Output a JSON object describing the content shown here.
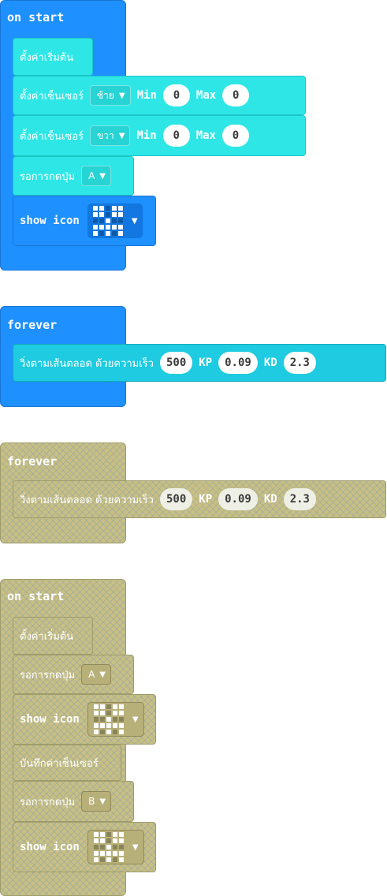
{
  "block1": {
    "hat": "on start",
    "init_label": "ตั้งค่าเริ่มต้น",
    "sensor_left": {
      "label": "ตั้งค่าเซ็นเซอร์",
      "side": "ซ้าย",
      "min_label": "Min",
      "min": "0",
      "max_label": "Max",
      "max": "0"
    },
    "sensor_right": {
      "label": "ตั้งค่าเซ็นเซอร์",
      "side": "ขวา",
      "min_label": "Min",
      "min": "0",
      "max_label": "Max",
      "max": "0"
    },
    "wait_button": {
      "label": "รอการกดปุ่ม",
      "button": "A"
    },
    "show_icon": {
      "label": "show icon"
    }
  },
  "block2": {
    "hat": "forever",
    "follow": {
      "label": "วิ่งตามเส้นตลอด ด้วยความเร็ว",
      "speed": "500",
      "kp_label": "KP",
      "kp": "0.09",
      "kd_label": "KD",
      "kd": "2.3"
    }
  },
  "block3": {
    "hat": "forever",
    "follow": {
      "label": "วิ่งตามเส้นตลอด ด้วยความเร็ว",
      "speed": "500",
      "kp_label": "KP",
      "kp": "0.09",
      "kd_label": "KD",
      "kd": "2.3"
    }
  },
  "block4": {
    "hat": "on start",
    "init_label": "ตั้งค่าเริ่มต้น",
    "wait_a": {
      "label": "รอการกดปุ่ม",
      "button": "A"
    },
    "show_icon_1": {
      "label": "show icon"
    },
    "record_label": "บันทึกค่าเซ็นเซอร์",
    "wait_b": {
      "label": "รอการกดปุ่ม",
      "button": "B"
    },
    "show_icon_2": {
      "label": "show icon"
    }
  },
  "icon_pattern": [
    [
      1,
      1,
      0,
      1,
      1
    ],
    [
      1,
      1,
      0,
      1,
      1
    ],
    [
      0,
      0,
      1,
      0,
      0
    ],
    [
      1,
      1,
      1,
      1,
      1
    ],
    [
      1,
      0,
      1,
      0,
      1
    ]
  ],
  "colors": {
    "event_blue": "#1e90ff",
    "custom_cyan": "#2ee6e6",
    "disabled_khaki": "#c8bf82"
  }
}
